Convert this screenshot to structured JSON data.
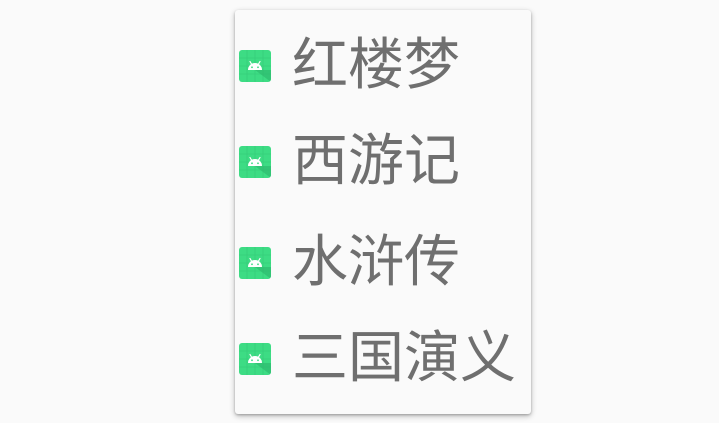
{
  "accent_color": "#3ddc84",
  "text_color": "#6f6f6f",
  "menu": {
    "items": [
      {
        "label": "红楼梦",
        "icon": "android-launcher-icon"
      },
      {
        "label": "西游记",
        "icon": "android-launcher-icon"
      },
      {
        "label": "水浒传",
        "icon": "android-launcher-icon"
      },
      {
        "label": "三国演义",
        "icon": "android-launcher-icon"
      }
    ]
  }
}
